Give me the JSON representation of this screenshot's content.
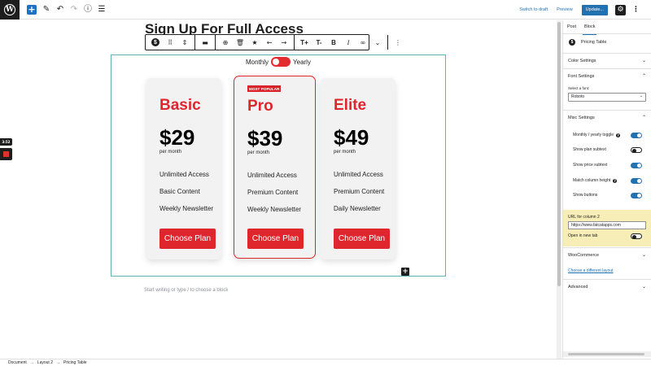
{
  "topbar": {
    "switch_to_draft": "Switch to draft",
    "preview": "Preview",
    "update": "Update...",
    "icons": [
      "wordpress-logo",
      "plus-icon",
      "pencil-icon",
      "undo-icon",
      "redo-icon",
      "info-icon",
      "list-view-icon",
      "gear-icon",
      "more-vertical-icon"
    ]
  },
  "recorder": {
    "time": "3:52"
  },
  "editor": {
    "page_title": "Sign Up For Full Access",
    "toggle": {
      "monthly_label": "Monthly",
      "yearly_label": "Yearly",
      "state": "monthly"
    },
    "placeholder": "Start writing or type / to choose a block",
    "plans": [
      {
        "name": "Basic",
        "price": "$29",
        "period": "per month",
        "features": [
          "Unlimited Access",
          "Basic Content",
          "Weekly Newsletter"
        ],
        "button": "Choose Plan",
        "badge": ""
      },
      {
        "name": "Pro",
        "price": "$39",
        "period": "per month",
        "features": [
          "Unlimited Access",
          "Premium Content",
          "Weekly Newsletter"
        ],
        "button": "Choose Plan",
        "badge": "MOST POPULAR"
      },
      {
        "name": "Elite",
        "price": "$49",
        "period": "per month",
        "features": [
          "Unlimited Access",
          "Premium Content",
          "Daily Newsletter"
        ],
        "button": "Choose Plan",
        "badge": ""
      }
    ],
    "accent_color": "#e0262d"
  },
  "block_toolbar": {
    "buttons": [
      "dollar-block-icon",
      "drag-handle-icon",
      "move-up-down-icon",
      "align-icon",
      "add-circle-icon",
      "trash-icon",
      "star-icon",
      "arrow-left-icon",
      "arrow-right-icon",
      "font-size-up-icon",
      "font-size-down-icon",
      "bold-icon",
      "italic-icon",
      "link-icon",
      "chevron-down-icon",
      "more-options-icon"
    ]
  },
  "sidebar": {
    "tabs": [
      "Post",
      "Block"
    ],
    "active_tab": "Block",
    "block_name": "Pricing Table",
    "panels": {
      "color_settings": "Color Settings",
      "font_settings": "Font Settings",
      "select_font_label": "Select a font:",
      "font_value": "Roboto",
      "misc_settings": "Misc Settings",
      "toggles": [
        {
          "label": "Monthly / yearly toggle",
          "on": true,
          "help": true
        },
        {
          "label": "Show plan subtext",
          "on": false,
          "help": false
        },
        {
          "label": "Show price subtext",
          "on": true,
          "help": false
        },
        {
          "label": "Match column height",
          "on": true,
          "help": true
        },
        {
          "label": "Show buttons",
          "on": true,
          "help": false
        }
      ],
      "url_label": "URL for column 2",
      "url_value": "https://www.fatcatapps.com",
      "open_new_tab_label": "Open in new tab",
      "woocommerce": "WooCommerce",
      "choose_layout_link": "Choose a different layout",
      "advanced": "Advanced"
    }
  },
  "footer": {
    "breadcrumb": [
      "Document",
      "Layout 2",
      "Pricing Table"
    ],
    "separator": "→"
  }
}
